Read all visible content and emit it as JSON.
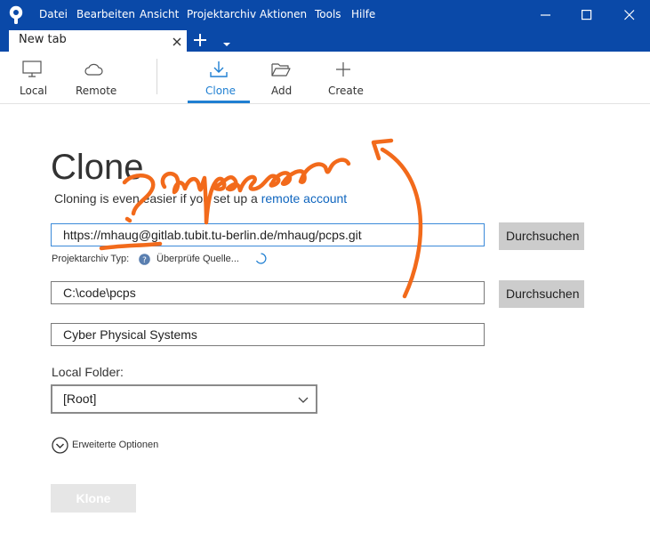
{
  "menu": {
    "items": [
      "Datei",
      "Bearbeiten",
      "Ansicht",
      "Projektarchiv",
      "Aktionen",
      "Tools",
      "Hilfe"
    ]
  },
  "icons": {
    "app_logo": "sourcetree-logo-icon",
    "minimize": "minimize-icon",
    "maximize": "maximize-icon",
    "close": "close-icon"
  },
  "tabs": {
    "active_label": "New tab",
    "add_icon": "plus-icon",
    "dropdown_icon": "caret-down-icon"
  },
  "toolbar": {
    "local": "Local",
    "remote": "Remote",
    "clone": "Clone",
    "add": "Add",
    "create": "Create"
  },
  "clone": {
    "title": "Clone",
    "hint_prefix": "Cloning is even easier if you set up a",
    "hint_link": "remote account",
    "source_url": "https://mhaug@gitlab.tubit.tu-berlin.de/mhaug/pcps.git",
    "browse_label": "Durchsuchen",
    "repo_type_label": "Projektarchiv Typ:",
    "checking_source": "Überprüfe Quelle...",
    "destination_path": "C:\\code\\pcps",
    "name": "Cyber Physical Systems",
    "local_folder_label": "Local Folder:",
    "local_folder_value": "[Root]",
    "advanced_options": "Erweiterte Optionen",
    "clone_button": "Klone"
  },
  "annotation": {
    "text": "?anpassen",
    "color": "#f26a1b"
  },
  "colors": {
    "titlebar": "#0a49a8",
    "accent": "#1f7fd2",
    "link": "#1066bf"
  }
}
